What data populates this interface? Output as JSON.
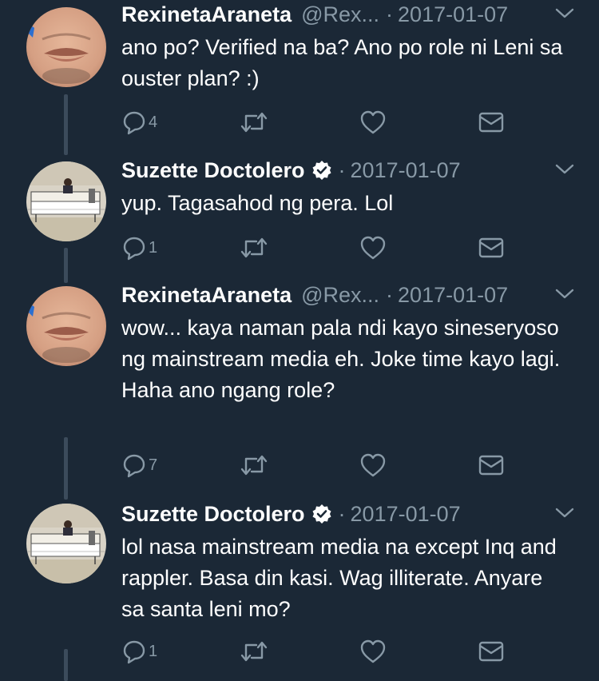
{
  "colors": {
    "background": "#1b2836",
    "text": "#ffffff",
    "secondary_text": "#8899a6",
    "thread_line": "#3c4b5b",
    "icon": "#8899a6"
  },
  "tweets": [
    {
      "display_name": "RexinetaAraneta",
      "handle": "@Rex...",
      "verified": false,
      "separator": "·",
      "date": "2017-01-07",
      "text": "ano po? Verified na ba? Ano po role ni Leni sa ouster plan? :)",
      "reply_count": "4",
      "avatar": "face-closeup"
    },
    {
      "display_name": "Suzette Doctolero",
      "handle": "",
      "verified": true,
      "separator": "·",
      "date": "2017-01-07",
      "text": "yup. Tagasahod ng pera. Lol",
      "reply_count": "1",
      "avatar": "conference-room"
    },
    {
      "display_name": "RexinetaAraneta",
      "handle": "@Rex...",
      "verified": false,
      "separator": "·",
      "date": "2017-01-07",
      "text": "wow... kaya naman pala ndi kayo sineseryoso ng mainstream media eh. Joke time kayo lagi. Haha ano ngang role?",
      "reply_count": "7",
      "avatar": "face-closeup"
    },
    {
      "display_name": "Suzette Doctolero",
      "handle": "",
      "verified": true,
      "separator": "·",
      "date": "2017-01-07",
      "text": "lol nasa mainstream media na except Inq and rappler. Basa din kasi. Wag illiterate. Anyare sa santa leni mo?",
      "reply_count": "1",
      "avatar": "conference-room"
    }
  ],
  "icons": {
    "reply": "reply-icon",
    "retweet": "retweet-icon",
    "like": "like-icon",
    "dm": "direct-message-icon",
    "more": "chevron-down-icon",
    "verified": "verified-badge-icon"
  }
}
